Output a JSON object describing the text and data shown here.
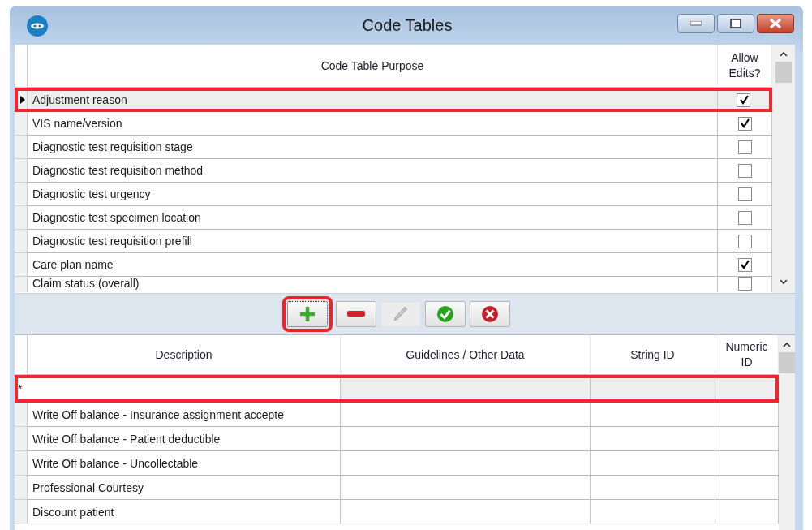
{
  "window": {
    "title": "Code Tables"
  },
  "code_tables": {
    "columns": [
      "Code Table Purpose",
      "Allow Edits?"
    ],
    "rows": [
      {
        "purpose": "Adjustment reason",
        "allow_edits": true,
        "selected": true,
        "highlighted": true
      },
      {
        "purpose": "VIS name/version",
        "allow_edits": true,
        "selected": false,
        "highlighted": false
      },
      {
        "purpose": "Diagnostic test requisition stage",
        "allow_edits": false,
        "selected": false,
        "highlighted": false
      },
      {
        "purpose": "Diagnostic test requisition method",
        "allow_edits": false,
        "selected": false,
        "highlighted": false
      },
      {
        "purpose": "Diagnostic test urgency",
        "allow_edits": false,
        "selected": false,
        "highlighted": false
      },
      {
        "purpose": "Diagnostic test specimen location",
        "allow_edits": false,
        "selected": false,
        "highlighted": false
      },
      {
        "purpose": "Diagnostic test requisition prefill",
        "allow_edits": false,
        "selected": false,
        "highlighted": false
      },
      {
        "purpose": "Care plan name",
        "allow_edits": true,
        "selected": false,
        "highlighted": false
      },
      {
        "purpose": "Claim status (overall)",
        "allow_edits": false,
        "selected": false,
        "highlighted": false
      }
    ]
  },
  "toolbar": {
    "buttons": [
      {
        "kind": "add",
        "disabled": false,
        "highlighted": true
      },
      {
        "kind": "remove",
        "disabled": false,
        "highlighted": false
      },
      {
        "kind": "edit",
        "disabled": true,
        "highlighted": false
      },
      {
        "kind": "accept",
        "disabled": false,
        "highlighted": false
      },
      {
        "kind": "cancel",
        "disabled": false,
        "highlighted": false
      }
    ]
  },
  "codes": {
    "columns": [
      "Description",
      "Guidelines / Other Data",
      "String ID",
      "Numeric ID"
    ],
    "new_row": {
      "marker": "*",
      "highlighted": true
    },
    "rows": [
      {
        "description": "Write Off balance - Insurance assignment accepte"
      },
      {
        "description": "Write Off balance - Patient deductible"
      },
      {
        "description": "Write Off balance - Uncollectable"
      },
      {
        "description": "Professional Courtesy"
      },
      {
        "description": "Discount patient"
      }
    ]
  }
}
